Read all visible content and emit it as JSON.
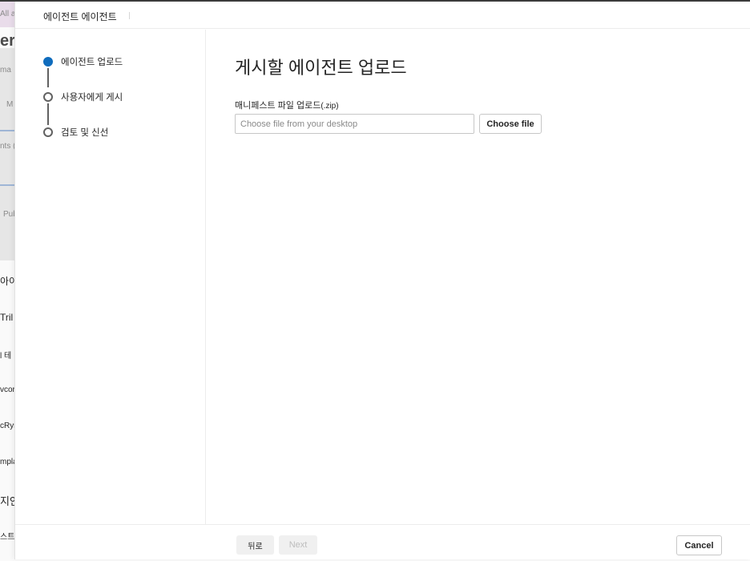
{
  "background": {
    "items": [
      "All a",
      "er",
      "ma",
      "M",
      "nts (",
      "Pub",
      "아이팍",
      "Tril",
      "l 테",
      "vcor",
      "cRys",
      "mpla",
      "지안",
      "스트 통제"
    ]
  },
  "panel": {
    "title": "에이전트 에이전트"
  },
  "steps": [
    {
      "label": "에이전트 업로드",
      "active": true
    },
    {
      "label": "사용자에게 게시",
      "active": false
    },
    {
      "label": "검토 및 신선",
      "active": false
    }
  ],
  "main": {
    "heading": "게시할 에이전트 업로드",
    "field_label": "매니페스트 파일 업로드",
    "field_ext": "(.zip)",
    "file_placeholder": "Choose file from your desktop",
    "file_value": "",
    "choose_button": "Choose file"
  },
  "footer": {
    "back_label": "뒤로",
    "next_label": "Next",
    "cancel_label": "Cancel"
  },
  "colors": {
    "accent": "#0f6cbd",
    "step_inactive": "#616161",
    "text": "#242424",
    "border": "#c7c7c7"
  }
}
